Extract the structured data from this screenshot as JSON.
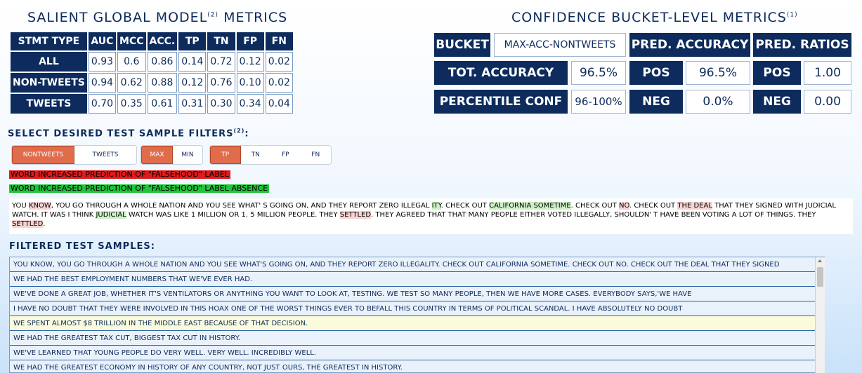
{
  "global_metrics": {
    "title": "Salient Global Model",
    "title_sup": "(2)",
    "title_rest": "Metrics",
    "headers": [
      "STMT TYPE",
      "AUC",
      "MCC",
      "ACC.",
      "TP",
      "TN",
      "FP",
      "FN"
    ],
    "rows": [
      {
        "label": "ALL",
        "values": [
          "0.93",
          "0.6",
          "0.86",
          "0.14",
          "0.72",
          "0.12",
          "0.02"
        ]
      },
      {
        "label": "NON-TWEETS",
        "values": [
          "0.94",
          "0.62",
          "0.88",
          "0.12",
          "0.76",
          "0.10",
          "0.02"
        ]
      },
      {
        "label": "TWEETS",
        "values": [
          "0.70",
          "0.35",
          "0.61",
          "0.31",
          "0.30",
          "0.34",
          "0.04"
        ]
      }
    ]
  },
  "confidence": {
    "title": "Confidence Bucket-Level Metrics",
    "title_sup": "(1)",
    "bucket_label": "BUCKET",
    "bucket_value": "MAX-ACC-NONTWEETS",
    "pred_accuracy_label": "PRED. ACCURACY",
    "pred_ratios_label": "PRED. RATIOS",
    "tot_accuracy_label": "TOT. ACCURACY",
    "tot_accuracy_value": "96.5%",
    "pos_label": "POS",
    "pos_accuracy": "96.5%",
    "pos_ratio": "1.00",
    "percentile_label": "PERCENTILE CONF",
    "percentile_value": "96-100%",
    "neg_label": "NEG",
    "neg_accuracy": "0.0%",
    "neg_ratio": "0.00"
  },
  "filters": {
    "title": "Select Desired Test Sample Filters",
    "title_sup": "(2)",
    "group1": [
      "NONTWEETS",
      "TWEETS"
    ],
    "group2": [
      "MAX",
      "MIN"
    ],
    "group3": [
      "TP",
      "TN",
      "FP",
      "FN"
    ],
    "colors": {
      "active": "#e06c4c",
      "inactive": "#ffffff"
    }
  },
  "legend": {
    "red": "WORD INCREASED PREDICTION OF \"FALSEHOOD\" LABEL",
    "green": "WORD INCREASED PREDICTION OF \"FALSEHOOD\" LABEL ABSENCE",
    "red_color": "#e01a1a",
    "green_color": "#22c43a"
  },
  "sample": {
    "segments": [
      {
        "t": "YOU ",
        "h": ""
      },
      {
        "t": "KNOW",
        "h": "r"
      },
      {
        "t": ", YOU GO THROUGH A WHOLE NATION AND YOU SEE WHAT' S GOING ON, AND THEY REPORT ZERO ILLEGAL ",
        "h": ""
      },
      {
        "t": "ITY",
        "h": "g"
      },
      {
        "t": ". CHECK OUT ",
        "h": ""
      },
      {
        "t": "CALIFORNIA SOMETIME",
        "h": "g"
      },
      {
        "t": ". CHECK OUT ",
        "h": ""
      },
      {
        "t": "NO",
        "h": "r"
      },
      {
        "t": ". CHECK OUT ",
        "h": ""
      },
      {
        "t": "THE DEAL",
        "h": "r"
      },
      {
        "t": " THAT THEY SIGNED WITH JUDICIAL WATCH. IT WAS I THINK ",
        "h": ""
      },
      {
        "t": "JUDICIAL",
        "h": "g"
      },
      {
        "t": " WATCH WAS LIKE 1 MILLION OR 1. 5 MILLION PEOPLE. THEY ",
        "h": ""
      },
      {
        "t": "SETTLED",
        "h": "r"
      },
      {
        "t": ". THEY AGREED THAT THAT MANY PEOPLE EITHER VOTED ILLEGALLY, SHOULDN' T HAVE BEEN VOTING A LOT OF THINGS. THEY ",
        "h": ""
      },
      {
        "t": "SETTLED",
        "h": "r"
      },
      {
        "t": ".",
        "h": ""
      }
    ]
  },
  "filtered": {
    "title": "Filtered Test Samples:",
    "rows": [
      "YOU KNOW, YOU GO THROUGH A WHOLE NATION AND YOU SEE WHAT'S GOING ON, AND THEY REPORT ZERO ILLEGALITY. CHECK OUT CALIFORNIA SOMETIME. CHECK OUT NO. CHECK OUT THE DEAL THAT THEY SIGNED",
      "WE HAD THE BEST EMPLOYMENT NUMBERS THAT WE'VE EVER HAD.",
      "WE'VE DONE A GREAT JOB, WHETHER IT'S VENTILATORS OR ANYTHING YOU WANT TO LOOK AT, TESTING. WE TEST SO MANY PEOPLE, THEN WE HAVE MORE CASES. EVERYBODY SAYS,'WE HAVE",
      "I HAVE NO DOUBT THAT THEY WERE INVOLVED IN THIS HOAX ONE OF THE WORST THINGS EVER TO BEFALL THIS COUNTRY IN TERMS OF POLITICAL SCANDAL. I HAVE ABSOLUTELY NO DOUBT",
      "WE SPENT ALMOST $8 TRILLION IN THE MIDDLE EAST BECAUSE OF THAT DECISION.",
      "WE HAD THE GREATEST TAX CUT, BIGGEST TAX CUT IN HISTORY.",
      "WE'VE LEARNED THAT YOUNG PEOPLE DO VERY WELL. VERY WELL. INCREDIBLY WELL.",
      "WE HAD THE GREATEST ECONOMY IN HISTORY OF ANY COUNTRY, NOT JUST OURS, THE GREATEST IN HISTORY."
    ],
    "highlighted_index": 4
  }
}
